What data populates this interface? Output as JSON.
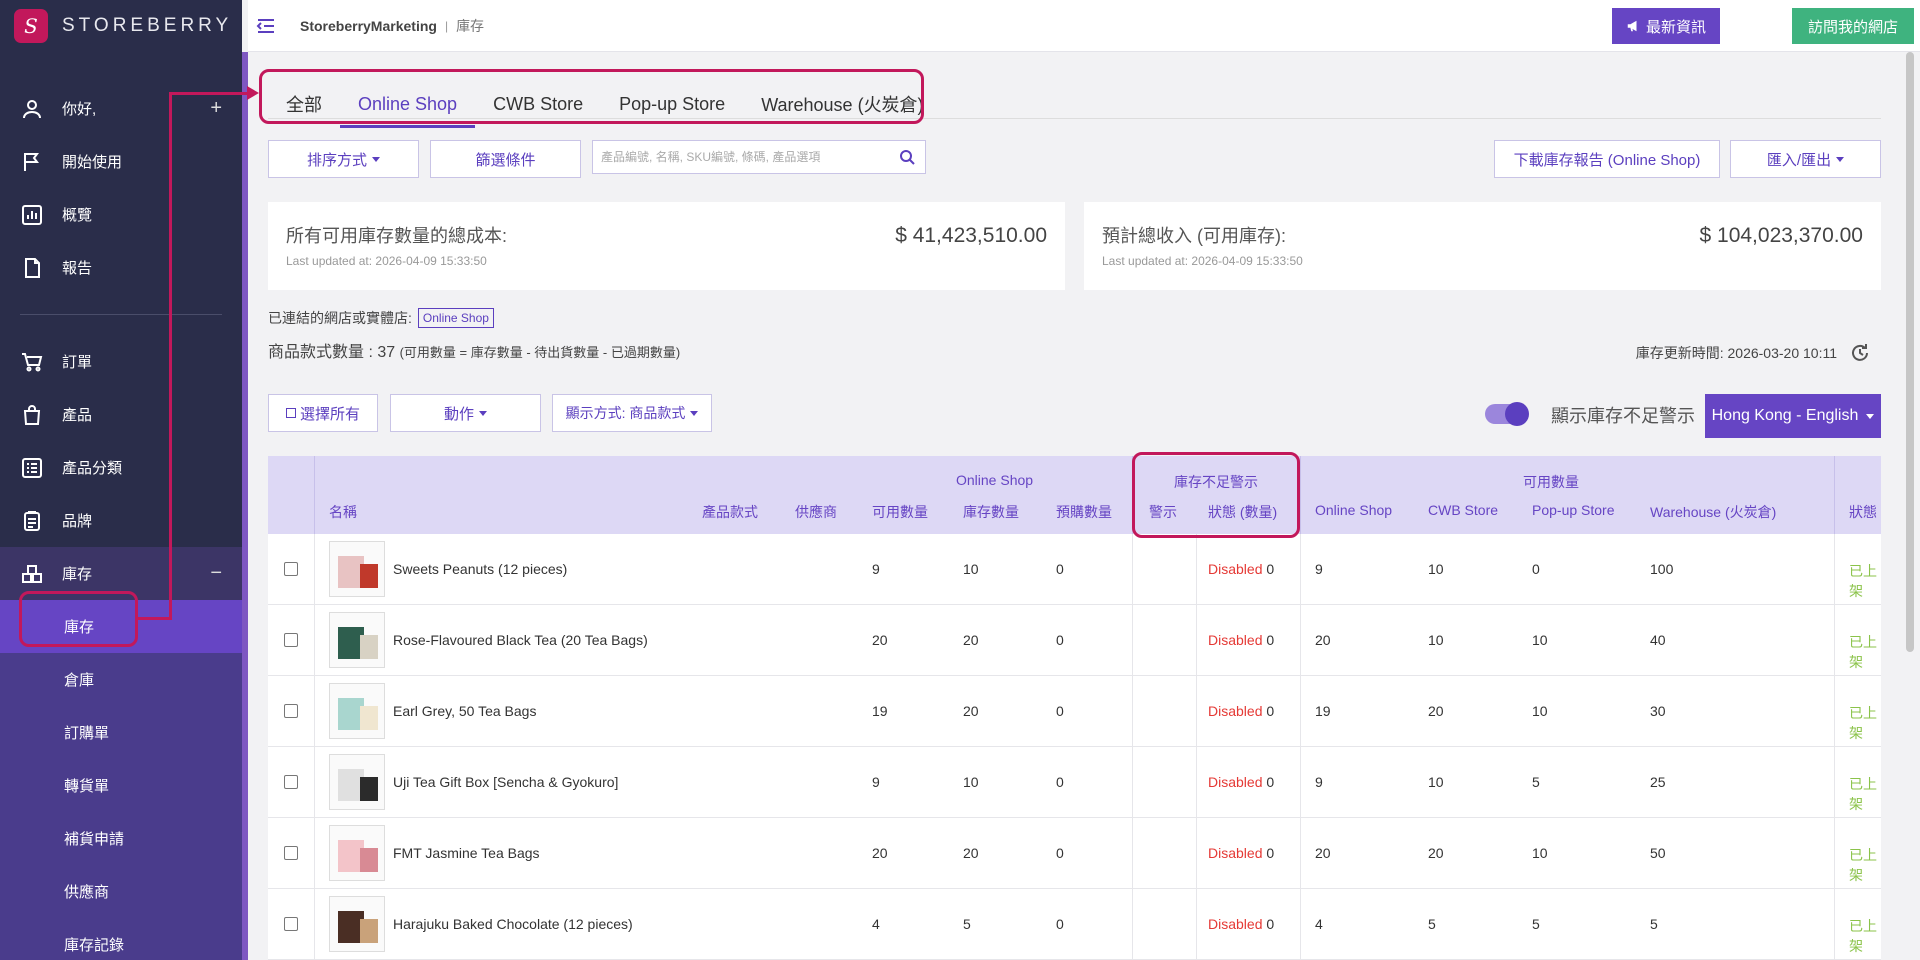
{
  "brand": {
    "name": "STOREBERRY",
    "logo_glyph": "S"
  },
  "sidebar": {
    "items": [
      {
        "label": "你好,",
        "icon": "user-icon",
        "trail": "+"
      },
      {
        "label": "開始使用",
        "icon": "flag-icon"
      },
      {
        "label": "概覽",
        "icon": "chart-icon"
      },
      {
        "label": "報告",
        "icon": "document-icon"
      },
      {
        "label": "訂單",
        "icon": "cart-icon"
      },
      {
        "label": "產品",
        "icon": "bag-icon"
      },
      {
        "label": "產品分類",
        "icon": "list-icon"
      },
      {
        "label": "品牌",
        "icon": "clipboard-icon"
      },
      {
        "label": "庫存",
        "icon": "inventory-icon",
        "trail": "−"
      }
    ],
    "sub_items": [
      {
        "label": "庫存",
        "active": true
      },
      {
        "label": "倉庫"
      },
      {
        "label": "訂購單"
      },
      {
        "label": "轉貨單"
      },
      {
        "label": "補貨申請"
      },
      {
        "label": "供應商"
      },
      {
        "label": "庫存記錄"
      }
    ]
  },
  "topbar": {
    "store": "StoreberryMarketing",
    "separator": "|",
    "page": "庫存",
    "news_label": "最新資訊",
    "visit_label": "訪問我的網店"
  },
  "tabs": [
    {
      "label": "全部"
    },
    {
      "label": "Online Shop",
      "active": true
    },
    {
      "label": "CWB Store"
    },
    {
      "label": "Pop-up Store"
    },
    {
      "label": "Warehouse (火炭倉)"
    }
  ],
  "toolbar": {
    "sort_label": "排序方式",
    "filter_label": "篩選條件",
    "search_placeholder": "產品編號, 名稱, SKU編號, 條碼, 產品選項",
    "download_label": "下載庫存報告 (Online Shop)",
    "import_export_label": "匯入/匯出"
  },
  "summary": {
    "cost_label": "所有可用庫存數量的總成本:",
    "cost_updated": "Last updated at: 2026-04-09 15:33:50",
    "cost_value": "$ 41,423,510.00",
    "revenue_label": "預計總收入 (可用庫存):",
    "revenue_updated": "Last updated at: 2026-04-09 15:33:50",
    "revenue_value": "$ 104,023,370.00"
  },
  "info": {
    "linked_label": "已連結的網店或實體店:",
    "linked_badge": "Online Shop",
    "count_text": "商品款式數量 : 37",
    "count_formula": "(可用數量 = 庫存數量 - 待出貨數量 - 已過期數量)",
    "inventory_time": "庫存更新時間: 2026-03-20 10:11"
  },
  "actions": {
    "select_all": "選擇所有",
    "action_label": "動作",
    "display_label": "顯示方式: 商品款式",
    "toggle_label": "顯示庫存不足警示",
    "lang_label": "Hong Kong - English"
  },
  "table": {
    "group_online": "Online Shop",
    "group_low": "庫存不足警示",
    "group_avail": "可用數量",
    "headers": {
      "name": "名稱",
      "variant": "產品款式",
      "supplier": "供應商",
      "available": "可用數量",
      "stock": "庫存數量",
      "preorder": "預購數量",
      "alert": "警示",
      "alert_status": "狀態 (數量)",
      "av_online": "Online Shop",
      "av_cwb": "CWB Store",
      "av_popup": "Pop-up Store",
      "av_warehouse": "Warehouse (火炭倉)",
      "status": "狀態"
    },
    "rows": [
      {
        "name": "Sweets Peanuts (12 pieces)",
        "available": "9",
        "stock": "10",
        "preorder": "0",
        "alert_status": "Disabled",
        "alert_qty": "0",
        "av_online": "9",
        "av_cwb": "10",
        "av_popup": "0",
        "av_warehouse": "100",
        "status": "已上架"
      },
      {
        "name": "Rose-Flavoured Black Tea (20 Tea Bags)",
        "available": "20",
        "stock": "20",
        "preorder": "0",
        "alert_status": "Disabled",
        "alert_qty": "0",
        "av_online": "20",
        "av_cwb": "10",
        "av_popup": "10",
        "av_warehouse": "40",
        "status": "已上架"
      },
      {
        "name": "Earl Grey, 50 Tea Bags",
        "available": "19",
        "stock": "20",
        "preorder": "0",
        "alert_status": "Disabled",
        "alert_qty": "0",
        "av_online": "19",
        "av_cwb": "20",
        "av_popup": "10",
        "av_warehouse": "30",
        "status": "已上架"
      },
      {
        "name": "Uji Tea Gift Box [Sencha & Gyokuro]",
        "available": "9",
        "stock": "10",
        "preorder": "0",
        "alert_status": "Disabled",
        "alert_qty": "0",
        "av_online": "9",
        "av_cwb": "10",
        "av_popup": "5",
        "av_warehouse": "25",
        "status": "已上架"
      },
      {
        "name": "FMT Jasmine Tea Bags",
        "available": "20",
        "stock": "20",
        "preorder": "0",
        "alert_status": "Disabled",
        "alert_qty": "0",
        "av_online": "20",
        "av_cwb": "20",
        "av_popup": "10",
        "av_warehouse": "50",
        "status": "已上架"
      },
      {
        "name": "Harajuku Baked Chocolate (12 pieces)",
        "available": "4",
        "stock": "5",
        "preorder": "0",
        "alert_status": "Disabled",
        "alert_qty": "0",
        "av_online": "4",
        "av_cwb": "5",
        "av_popup": "5",
        "av_warehouse": "5",
        "status": "已上架"
      }
    ]
  },
  "colors": {
    "accent": "#6645c4",
    "sidebar": "#2a2d4a",
    "highlight": "#c2185b",
    "visit": "#3fb37f"
  }
}
